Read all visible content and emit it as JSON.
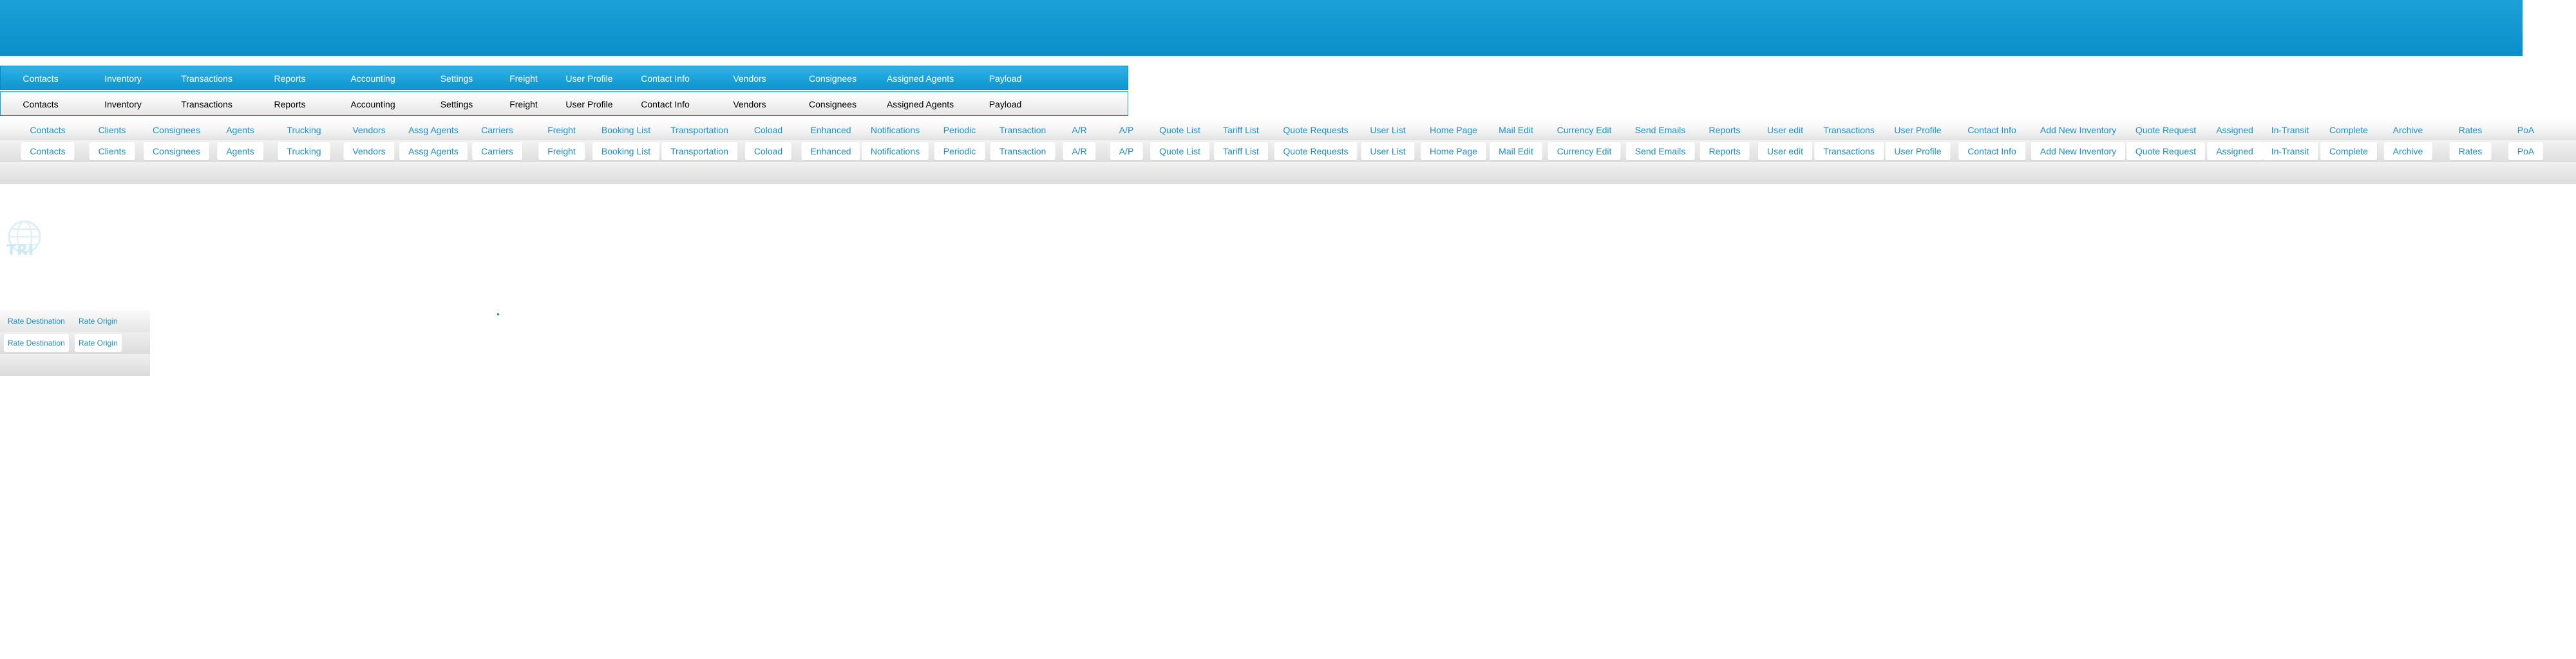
{
  "menu": {
    "items": [
      "Contacts",
      "Inventory",
      "Transactions",
      "Reports",
      "Accounting",
      "Settings",
      "Freight",
      "User Profile",
      "Contact Info",
      "Vendors",
      "Consignees",
      "Assigned Agents",
      "Payload"
    ]
  },
  "tabs": {
    "items": [
      "Contacts",
      "Clients",
      "Consignees",
      "Agents",
      "Trucking",
      "Vendors",
      "Assg Agents",
      "Carriers",
      "Freight",
      "Booking List",
      "Transportation",
      "Coload",
      "Enhanced",
      "Notifications",
      "Periodic",
      "Transaction",
      "A/R",
      "A/P",
      "Quote List",
      "Tariff List",
      "Quote Requests",
      "User List",
      "Home Page",
      "Mail Edit",
      "Currency Edit",
      "Send Emails",
      "Reports",
      "User edit",
      "Transactions",
      "User Profile",
      "Contact Info",
      "Add New Inventory",
      "Quote Request",
      "Assigned",
      "In-Transit",
      "Complete",
      "Archive",
      "Rates",
      "PoA"
    ]
  },
  "logo": {
    "text": "TRI"
  },
  "rate_tabs": {
    "items": [
      "Rate Destination",
      "Rate Origin"
    ]
  },
  "colors": {
    "accent": "#1d8fc9",
    "banner": "#0a8fc9"
  }
}
